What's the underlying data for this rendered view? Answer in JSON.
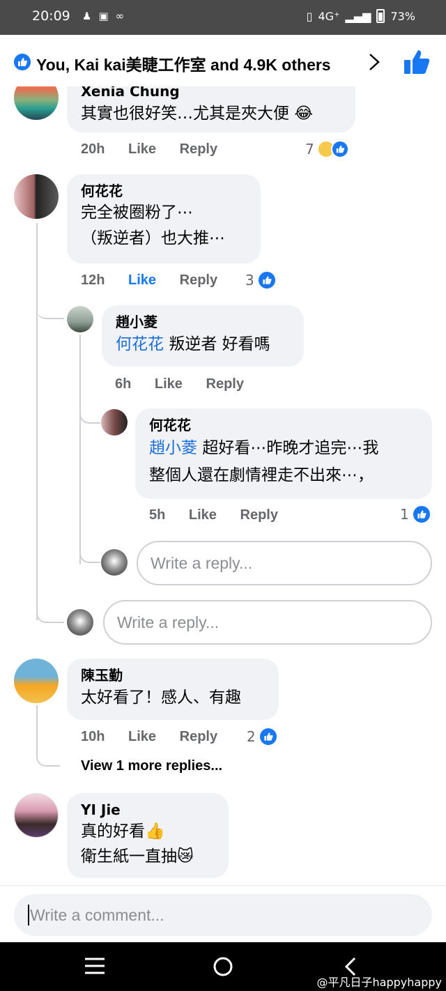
{
  "status_bar": {
    "time": "20:09",
    "network": "4G⁺",
    "battery": "73%"
  },
  "reactions_header": {
    "summary": "You, Kai kai美睫工作室 and 4.9K others"
  },
  "comments": [
    {
      "author": "Xenia Chung",
      "lines": [
        "其實也很好笑…尤其是夾大便 😂"
      ],
      "time": "20h",
      "like": "Like",
      "reply": "Reply",
      "reaction_count": "7"
    },
    {
      "author": "何花花",
      "lines": [
        "完全被圈粉了⋯",
        "（叛逆者）也大推⋯"
      ],
      "time": "12h",
      "like": "Like",
      "reply": "Reply",
      "reaction_count": "3",
      "liked": true
    },
    {
      "author": "趙小菱",
      "mention": "何花花",
      "lines": [
        "叛逆者 好看嗎"
      ],
      "time": "6h",
      "like": "Like",
      "reply": "Reply"
    },
    {
      "author": "何花花",
      "mention": "趙小菱",
      "lines": [
        "超好看⋯昨晚才追完⋯我",
        "整個人還在劇情裡走不出來⋯，"
      ],
      "time": "5h",
      "like": "Like",
      "reply": "Reply",
      "reaction_count": "1"
    },
    {
      "author": "陳玉勤",
      "lines": [
        "太好看了！感人、有趣"
      ],
      "time": "10h",
      "like": "Like",
      "reply": "Reply",
      "reaction_count": "2",
      "more_replies": "View 1 more replies..."
    },
    {
      "author": "YI Jie",
      "lines": [
        "真的好看👍",
        "衛生紙一直抽😿"
      ]
    }
  ],
  "reply_placeholder": "Write a reply...",
  "comment_placeholder": "Write a comment...",
  "watermark": "@平凡日子happyhappy",
  "colors": {
    "accent": "#1877f2",
    "bubble": "#f0f2f5",
    "meta": "#65676b"
  }
}
